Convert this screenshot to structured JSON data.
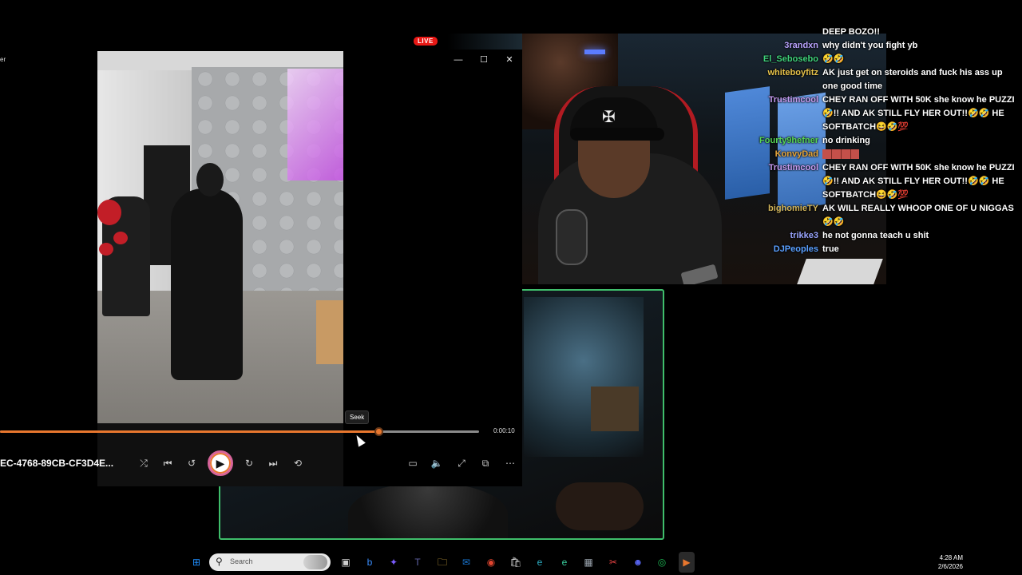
{
  "stream": {
    "live_badge": "LIVE"
  },
  "chat": {
    "messages": [
      {
        "user": "",
        "text": "DEEP BOZO!!",
        "color": "#ffffff"
      },
      {
        "user": "3randxn",
        "text": "why didn't you fight yb",
        "color": "#b9a3ff"
      },
      {
        "user": "El_Sebosebo",
        "text": "🤣🤣",
        "color": "#3fd27b"
      },
      {
        "user": "whiteboyfitz",
        "text": "AK just get on steroids and fuck his ass up one good time",
        "color": "#e7c24a"
      },
      {
        "user": "Trustimcool",
        "text": "CHEY RAN OFF WITH 50K she know he PUZZI 🤣!! AND AK STILL FLY HER OUT!!🤣🤣 HE SOFTBATCH😆🤣💯",
        "color": "#c79cf0"
      },
      {
        "user": "Fourty9hefner",
        "text": "no drinking",
        "color": "#57d656"
      },
      {
        "user": "KonvyDad",
        "text": "",
        "color": "#e4a53c",
        "emote": true
      },
      {
        "user": "Trustimcool",
        "text": "CHEY RAN OFF WITH 50K she know he PUZZI 🤣!! AND AK STILL FLY HER OUT!!🤣🤣 HE SOFTBATCH😆🤣💯",
        "color": "#c79cf0"
      },
      {
        "user": "bighomieTY",
        "text": "AK WILL REALLY WHOOP ONE OF U NIGGAS🤣🤣",
        "color": "#d1b45a"
      },
      {
        "user": "trikke3",
        "text": "he not gonna teach u shit",
        "color": "#9aa5ff"
      },
      {
        "user": "DJPeoples",
        "text": "true",
        "color": "#5aa0ff"
      }
    ]
  },
  "player": {
    "app_title": "er",
    "minimize": "—",
    "maximize": "☐",
    "close": "✕",
    "tooltip": "Seek",
    "progress": 0.79,
    "time": "0:00:10",
    "file_name": "EC-4768-89CB-CF3D4E...",
    "controls": {
      "shuffle": "⤮",
      "previous": "⏮",
      "rewind": "↺",
      "play": "▶",
      "forward": "↻",
      "next": "⏭",
      "repeat": "⟲",
      "subtitles": "▭",
      "volume": "🔈",
      "fullscreen": "⤢",
      "miniplayer": "⧉",
      "more": "⋯"
    }
  },
  "taskbar": {
    "search_placeholder": "Search",
    "time": "4:28 AM",
    "date": "2/6/2026",
    "icons": [
      {
        "name": "windows-start-icon",
        "glyph": "⊞",
        "color": "#1f8fff"
      },
      {
        "name": "task-view-icon",
        "glyph": "▣",
        "color": "#cfcfcf"
      },
      {
        "name": "bing-icon",
        "glyph": "b",
        "color": "#3a8eff"
      },
      {
        "name": "copilot-icon",
        "glyph": "✦",
        "color": "#7c5cff"
      },
      {
        "name": "teams-icon",
        "glyph": "T",
        "color": "#6264a7"
      },
      {
        "name": "file-explorer-icon",
        "glyph": "🗀",
        "color": "#f2c14b"
      },
      {
        "name": "outlook-icon",
        "glyph": "✉",
        "color": "#1976d2"
      },
      {
        "name": "chrome-icon",
        "glyph": "◉",
        "color": "#e0452f"
      },
      {
        "name": "store-icon",
        "glyph": "🛍",
        "color": "#cfcfcf"
      },
      {
        "name": "edge-icon",
        "glyph": "e",
        "color": "#2db0c6"
      },
      {
        "name": "edge-beta-icon",
        "glyph": "e",
        "color": "#3ad0a0"
      },
      {
        "name": "calculator-icon",
        "glyph": "▦",
        "color": "#9aa3ad"
      },
      {
        "name": "snipping-tool-icon",
        "glyph": "✂",
        "color": "#e44"
      },
      {
        "name": "discord-icon",
        "glyph": "☻",
        "color": "#5865f2"
      },
      {
        "name": "spotify-icon",
        "glyph": "◎",
        "color": "#1db954"
      },
      {
        "name": "media-player-icon",
        "glyph": "▶",
        "color": "#e8772e"
      }
    ]
  }
}
